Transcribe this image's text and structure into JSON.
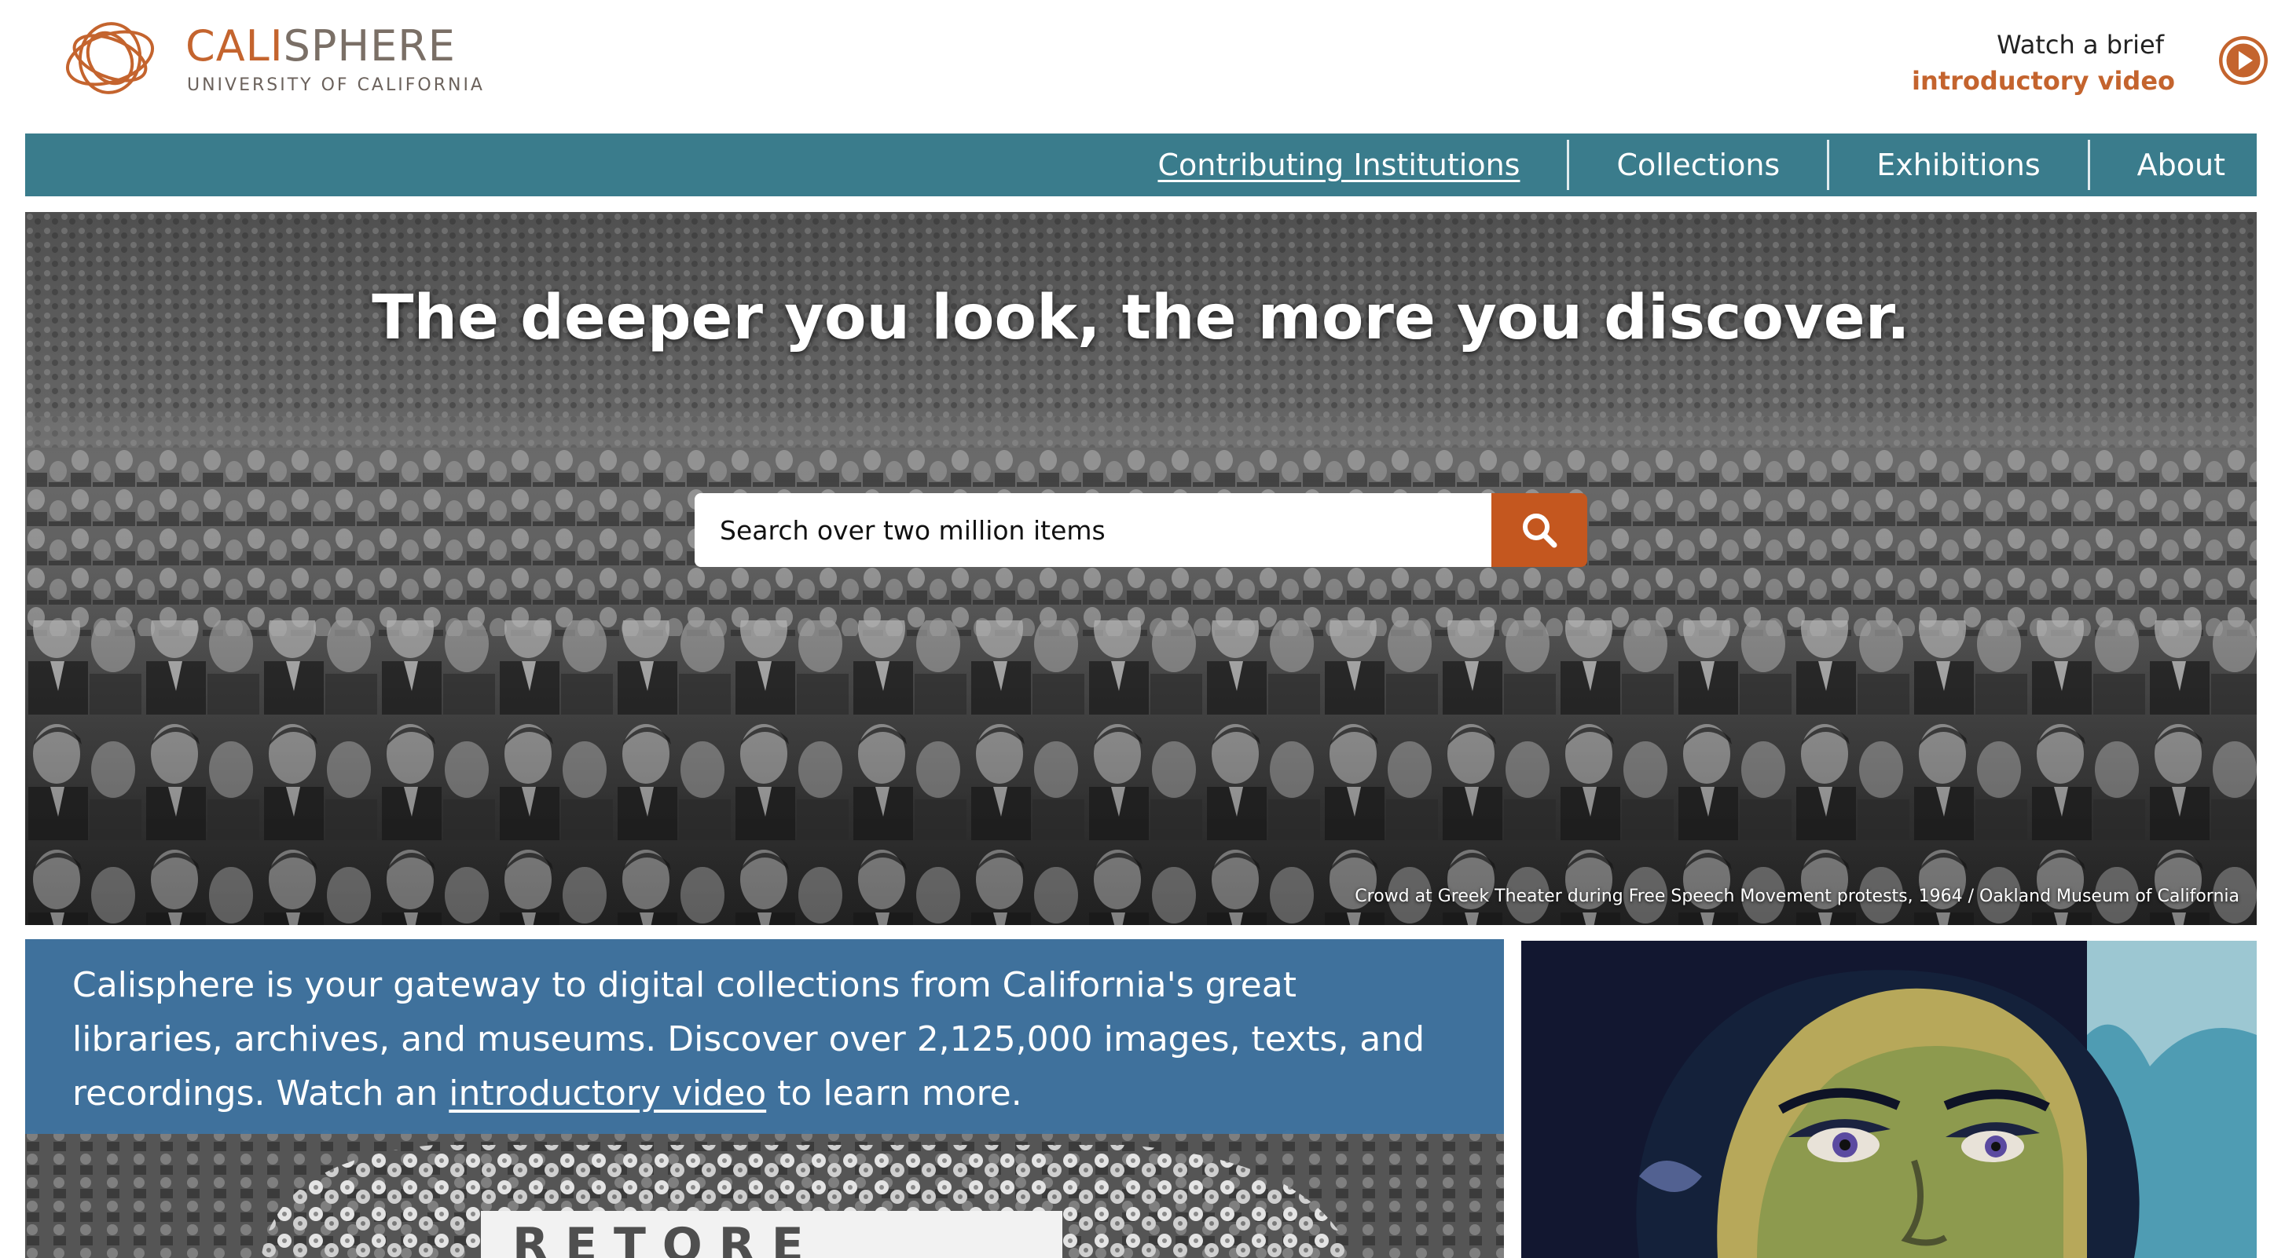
{
  "brand": {
    "name_accent": "CALI",
    "name_rest": "SPHERE",
    "subtitle": "UNIVERSITY OF CALIFORNIA",
    "colors": {
      "orange": "#c4642e",
      "teal": "#3a7c8c",
      "intro_blue": "#3e73a0"
    }
  },
  "video_promo": {
    "line1": "Watch a brief",
    "link": "introductory video",
    "icon": "play-icon"
  },
  "nav": {
    "items": [
      {
        "label": "Contributing Institutions",
        "active": true
      },
      {
        "label": "Collections",
        "active": false
      },
      {
        "label": "Exhibitions",
        "active": false
      },
      {
        "label": "About",
        "active": false
      }
    ]
  },
  "hero": {
    "title": "The deeper you look, the more you discover.",
    "search_placeholder": "Search over two million items",
    "search_icon": "search-icon",
    "caption": "Crowd at Greek Theater during Free Speech Movement protests, 1964 / Oakland Museum of California"
  },
  "intro": {
    "text_before": "Calisphere is your gateway to digital collections from California's great libraries, archives, and museums. Discover over 2,125,000 images, texts, and recordings. Watch an ",
    "link": "introductory video",
    "text_after": " to learn more."
  }
}
